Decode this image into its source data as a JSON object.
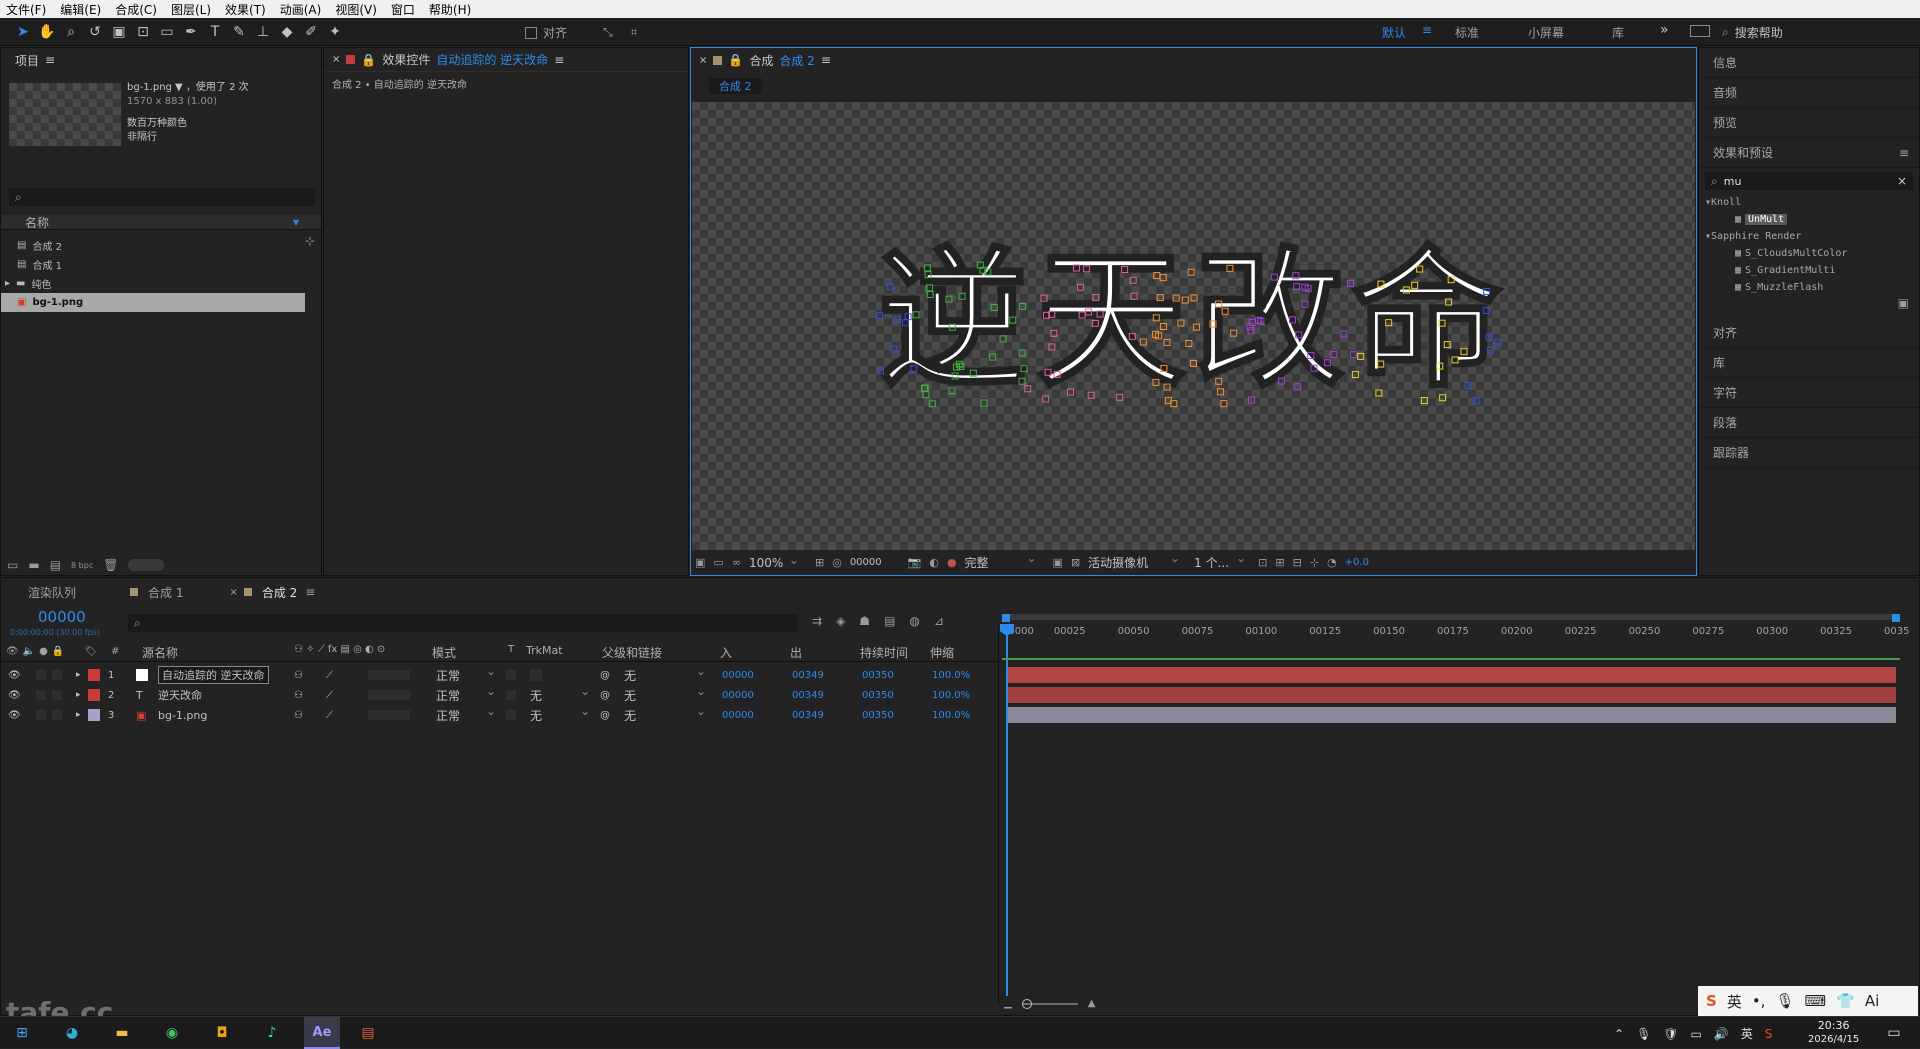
{
  "menu": [
    "文件(F)",
    "编辑(E)",
    "合成(C)",
    "图层(L)",
    "效果(T)",
    "动画(A)",
    "视图(V)",
    "窗口",
    "帮助(H)"
  ],
  "toolbar": {
    "align_label": "对齐",
    "workspaces": [
      "默认",
      "标准",
      "小屏幕",
      "库"
    ],
    "active_workspace": "默认",
    "search_placeholder": "搜索帮助"
  },
  "project": {
    "title": "项目",
    "file_name": "bg-1.png ▼",
    "used": "，使用了 2 次",
    "dims": "1570 x 883 (1.00)",
    "color": "数百万种颜色",
    "interlace": "非隔行",
    "col_name": "名称",
    "items": [
      {
        "label": "合成 2",
        "type": "comp"
      },
      {
        "label": "合成 1",
        "type": "comp"
      },
      {
        "label": "纯色",
        "type": "folder"
      },
      {
        "label": "bg-1.png",
        "type": "image"
      }
    ],
    "bpc": "8 bpc"
  },
  "effects_controls": {
    "title_prefix": "效果控件",
    "title_target": "自动追踪的 逆天改命",
    "breadcrumb": "合成 2 • 自动追踪的 逆天改命"
  },
  "composition": {
    "title_prefix": "合成",
    "title_name": "合成 2",
    "tab": "合成 2",
    "art_text": "逆天改命",
    "zoom": "100%",
    "timecode": "00000",
    "resolution": "完整",
    "camera": "活动摄像机",
    "views": "1 个...",
    "exposure": "+0.0"
  },
  "right_panels": {
    "top": [
      "信息",
      "音频",
      "预览"
    ],
    "effects_title": "效果和预设",
    "search_value": "mu",
    "tree": [
      {
        "group": "Knoll",
        "items": [
          "UnMult"
        ]
      },
      {
        "group": "Sapphire Render",
        "items": [
          "S_CloudsMultColor",
          "S_GradientMulti",
          "S_MuzzleFlash"
        ]
      }
    ],
    "bottom": [
      "对齐",
      "库",
      "字符",
      "段落",
      "跟踪器"
    ]
  },
  "timeline": {
    "tabs": [
      "渲染队列",
      "合成 1",
      "合成 2"
    ],
    "current_time": "00000",
    "current_time_sub": "0:00:00:00 (30.00 fps)",
    "headers": {
      "source": "源名称",
      "mode": "模式",
      "t": "T",
      "trkmat": "TrkMat",
      "parent": "父级和链接",
      "in": "入",
      "out": "出",
      "duration": "持续时间",
      "stretch": "伸缩"
    },
    "layers": [
      {
        "num": "1",
        "name": "自动追踪的 逆天改命",
        "color": "#c83c3c",
        "mode": "正常",
        "trkmat": "",
        "parent": "无",
        "in": "00000",
        "out": "00349",
        "dur": "00350",
        "stretch": "100.0%"
      },
      {
        "num": "2",
        "name": "逆天改命",
        "color": "#c83c3c",
        "mode": "正常",
        "trkmat": "无",
        "parent": "无",
        "in": "00000",
        "out": "00349",
        "dur": "00350",
        "stretch": "100.0%"
      },
      {
        "num": "3",
        "name": "bg-1.png",
        "color": "#a8a0c8",
        "mode": "正常",
        "trkmat": "无",
        "parent": "无",
        "in": "00000",
        "out": "00349",
        "dur": "00350",
        "stretch": "100.0%"
      }
    ],
    "ruler": [
      "00000",
      "00025",
      "00050",
      "00075",
      "00100",
      "00125",
      "00150",
      "00175",
      "00200",
      "00225",
      "00250",
      "00275",
      "00300",
      "00325",
      "0035"
    ]
  },
  "taskbar": {
    "ime_labels": [
      "英",
      "Ai"
    ],
    "tray_lang": "英",
    "time": "20:36",
    "date": "2026/4/15"
  },
  "watermark": "tafe.cc",
  "colors": {
    "accent": "#2d8ceb",
    "layer_red": "#c83c3c",
    "layer_lavender": "#a8a0c8",
    "bar_red": "#b24444",
    "bar_gray": "#8a8a9a"
  }
}
